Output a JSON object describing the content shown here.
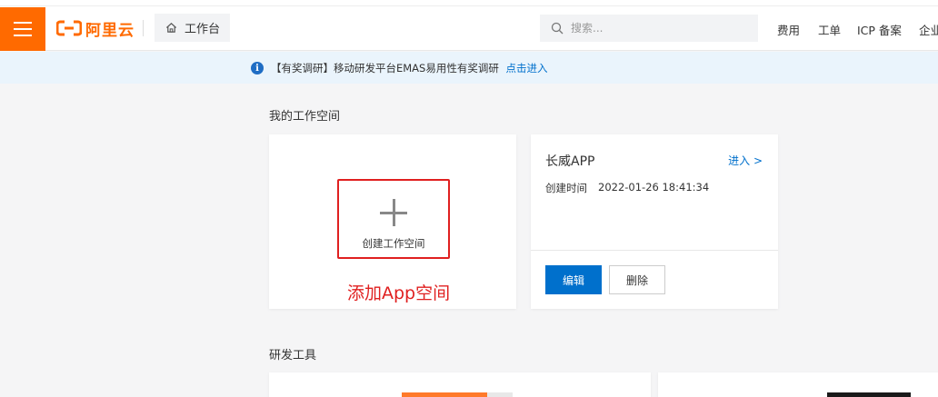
{
  "header": {
    "logo_text": "阿里云",
    "workbench_label": "工作台",
    "search_placeholder": "搜索...",
    "nav": [
      "费用",
      "工单",
      "ICP 备案",
      "企业"
    ]
  },
  "notice": {
    "text": "【有奖调研】移动研发平台EMAS易用性有奖调研",
    "link": "点击进入"
  },
  "workspace": {
    "title": "我的工作空间",
    "create_label": "创建工作空间",
    "annotation": "添加App空间",
    "app": {
      "name": "长威APP",
      "enter_label": "进入 >",
      "created_label": "创建时间",
      "created_value": "2022-01-26 18:41:34",
      "edit_label": "编辑",
      "delete_label": "删除"
    }
  },
  "tools": {
    "title": "研发工具"
  },
  "colors": {
    "brand": "#ff6a00",
    "link": "#0070cc",
    "annotation": "#e02020"
  }
}
